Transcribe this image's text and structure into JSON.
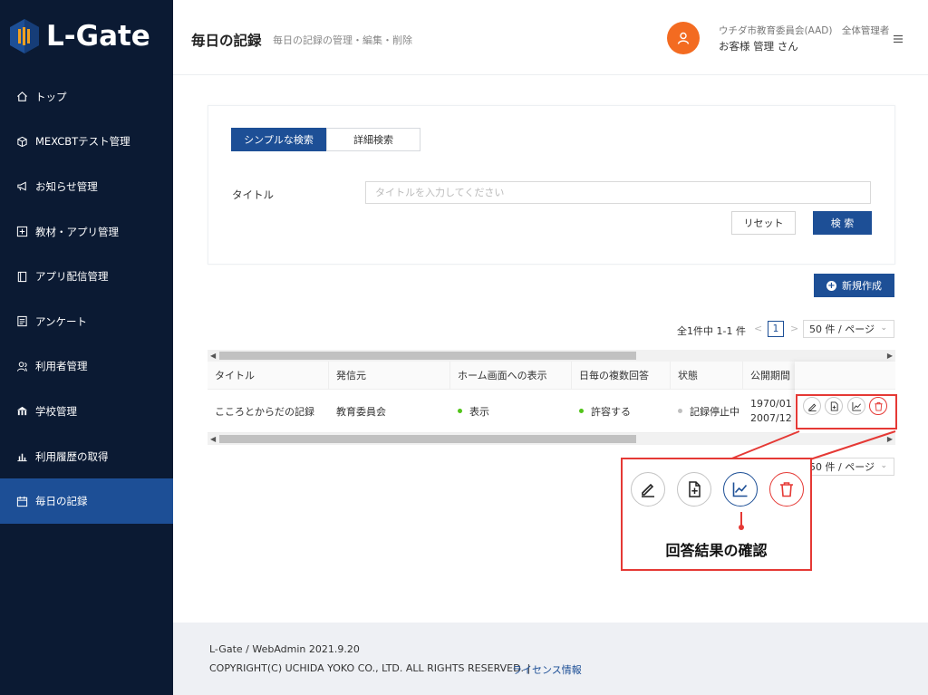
{
  "brand": {
    "name": "L-Gate"
  },
  "sidebar": {
    "items": [
      {
        "label": "トップ",
        "icon": "home-icon"
      },
      {
        "label": "MEXCBTテスト管理",
        "icon": "cube-icon"
      },
      {
        "label": "お知らせ管理",
        "icon": "megaphone-icon"
      },
      {
        "label": "教材・アプリ管理",
        "icon": "plus-square-icon"
      },
      {
        "label": "アプリ配信管理",
        "icon": "book-icon"
      },
      {
        "label": "アンケート",
        "icon": "survey-icon"
      },
      {
        "label": "利用者管理",
        "icon": "users-icon"
      },
      {
        "label": "学校管理",
        "icon": "school-icon"
      },
      {
        "label": "利用履歴の取得",
        "icon": "bar-chart-icon"
      },
      {
        "label": "毎日の記録",
        "icon": "calendar-icon"
      }
    ],
    "active_index": 9
  },
  "header": {
    "title": "毎日の記録",
    "subtitle": "毎日の記録の管理・編集・削除",
    "org": "ウチダ市教育委員会(AAD)　全体管理者",
    "user": "お客様 管理 さん"
  },
  "search": {
    "tab_simple": "シンプルな検索",
    "tab_detail": "詳細検索",
    "title_label": "タイトル",
    "title_placeholder": "タイトルを入力してください",
    "title_value": "",
    "reset_label": "リセット",
    "search_label": "検 索"
  },
  "new_button": "新規作成",
  "pagination": {
    "total_text": "全1件中 1-1 件",
    "prev": "<",
    "current_page": "1",
    "next": ">",
    "page_size": "50 件 / ページ"
  },
  "table": {
    "columns": [
      "タイトル",
      "発信元",
      "ホーム画面への表示",
      "日毎の複数回答",
      "状態",
      "公開期間"
    ],
    "rows": [
      {
        "title": "こころとからだの記録",
        "sender": "教育委員会",
        "home_display": "表示",
        "multi_answer": "許容する",
        "status": "記録停止中",
        "period_start": "1970/01",
        "period_end": "2007/12"
      }
    ]
  },
  "actions": [
    "edit-icon",
    "add-document-icon",
    "chart-icon",
    "trash-icon"
  ],
  "callout": {
    "label": "回答結果の確認"
  },
  "footer": {
    "version": "L-Gate / WebAdmin 2021.9.20",
    "copyright": "COPYRIGHT(C) UCHIDA YOKO CO., LTD. ALL RIGHTS RESERVED. |",
    "license_link": "ライセンス情報"
  },
  "colors": {
    "sidebar_bg": "#0b1a33",
    "primary": "#1d4f96",
    "accent_orange": "#f36b21",
    "highlight_red": "#e53935",
    "status_green": "#52c41a",
    "status_gray": "#bfbfbf"
  }
}
